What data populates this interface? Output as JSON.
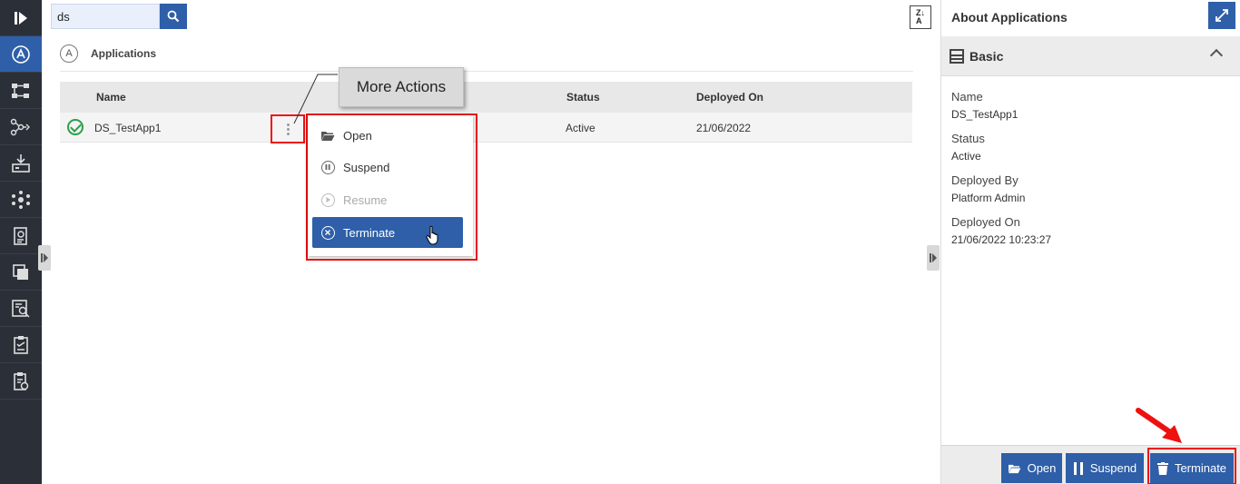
{
  "search": {
    "value": "ds"
  },
  "section": {
    "title": "Applications",
    "icon_letter": "A"
  },
  "table": {
    "columns": {
      "name": "Name",
      "status": "Status",
      "deployed_on": "Deployed On"
    },
    "rows": [
      {
        "name": "DS_TestApp1",
        "status": "Active",
        "deployed_on": "21/06/2022"
      }
    ]
  },
  "callout": {
    "label": "More Actions"
  },
  "menu": {
    "items": [
      {
        "label": "Open",
        "icon": "folder-open-icon",
        "state": "enabled"
      },
      {
        "label": "Suspend",
        "icon": "pause-circle-icon",
        "state": "enabled"
      },
      {
        "label": "Resume",
        "icon": "play-circle-icon",
        "state": "disabled"
      },
      {
        "label": "Terminate",
        "icon": "x-circle-icon",
        "state": "selected"
      }
    ]
  },
  "panel": {
    "title": "About Applications",
    "section_title": "Basic",
    "fields": [
      {
        "label": "Name",
        "value": "DS_TestApp1"
      },
      {
        "label": "Status",
        "value": "Active"
      },
      {
        "label": "Deployed By",
        "value": "Platform Admin"
      },
      {
        "label": "Deployed On",
        "value": "21/06/2022 10:23:27"
      }
    ],
    "buttons": {
      "open": "Open",
      "suspend": "Suspend",
      "terminate": "Terminate"
    }
  },
  "colors": {
    "accent": "#2e5fa8",
    "highlight": "#ee1111",
    "success": "#2aa04a",
    "rail": "#2b2f38"
  }
}
